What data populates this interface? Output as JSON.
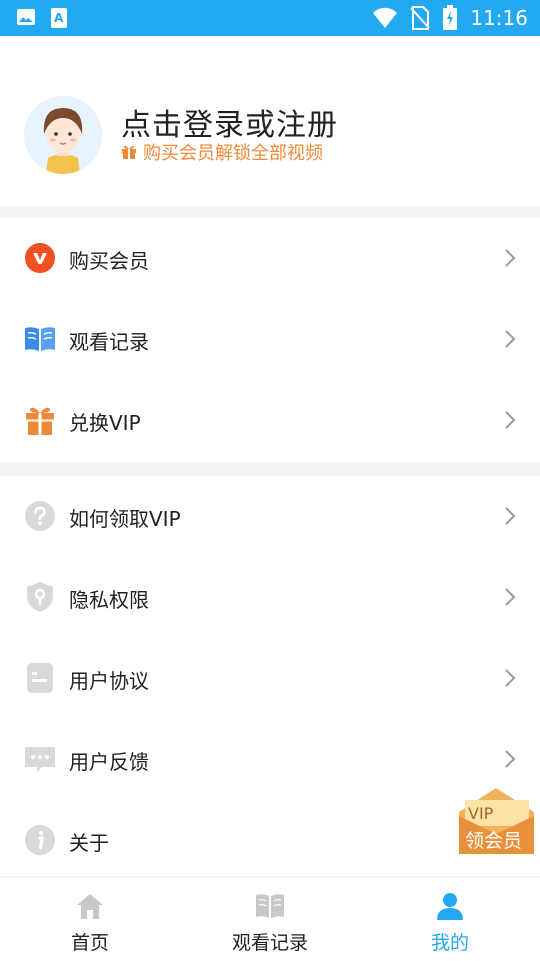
{
  "status_bar": {
    "time": "11:16"
  },
  "profile": {
    "title": "点击登录或注册",
    "subtitle": "购买会员解锁全部视频"
  },
  "menu_group_1": [
    {
      "label": "购买会员",
      "icon": "vip-badge-icon"
    },
    {
      "label": "观看记录",
      "icon": "book-icon"
    },
    {
      "label": "兑换VIP",
      "icon": "gift-icon"
    }
  ],
  "menu_group_2": [
    {
      "label": "如何领取VIP",
      "icon": "question-icon"
    },
    {
      "label": "隐私权限",
      "icon": "shield-icon"
    },
    {
      "label": "用户协议",
      "icon": "document-icon"
    },
    {
      "label": "用户反馈",
      "icon": "feedback-icon"
    },
    {
      "label": "关于",
      "icon": "info-icon"
    }
  ],
  "floating_vip": {
    "badge": "VIP",
    "label": "领会员"
  },
  "tabbar": [
    {
      "label": "首页",
      "icon": "home-icon",
      "active": false
    },
    {
      "label": "观看记录",
      "icon": "book-icon",
      "active": false
    },
    {
      "label": "我的",
      "icon": "user-icon",
      "active": true
    }
  ],
  "colors": {
    "accent": "#23a8f2",
    "vip_orange": "#f0893a",
    "vip_red": "#f25022"
  }
}
